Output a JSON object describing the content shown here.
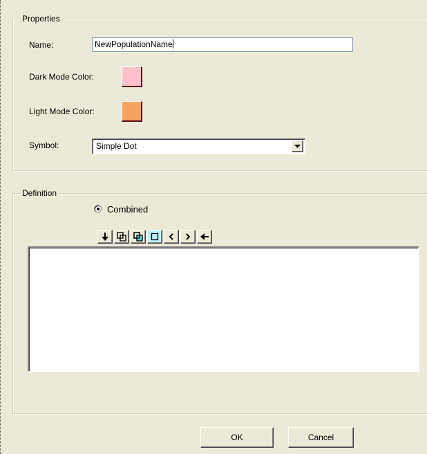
{
  "properties": {
    "group_title": "Properties",
    "name_label": "Name:",
    "name_value": "NewPopulationName",
    "dark_mode_label": "Dark Mode Color:",
    "dark_mode_color": "#FFC0CB",
    "light_mode_label": "Light Mode Color:",
    "light_mode_color": "#F4A460",
    "symbol_label": "Symbol:",
    "symbol_value": "Simple Dot"
  },
  "definition": {
    "group_title": "Definition",
    "mode_label": "Combined",
    "mode_selected": true,
    "toolbar": [
      {
        "name": "down-arrow-icon",
        "glyph": "↓"
      },
      {
        "name": "union-icon",
        "glyph": "⧉"
      },
      {
        "name": "intersect-icon",
        "glyph": "⧉"
      },
      {
        "name": "square-icon",
        "glyph": "□"
      },
      {
        "name": "left-chevron-icon",
        "glyph": "‹"
      },
      {
        "name": "right-chevron-icon",
        "glyph": "›"
      },
      {
        "name": "left-arrow-icon",
        "glyph": "←"
      }
    ]
  },
  "buttons": {
    "ok_label": "OK",
    "cancel_label": "Cancel"
  }
}
